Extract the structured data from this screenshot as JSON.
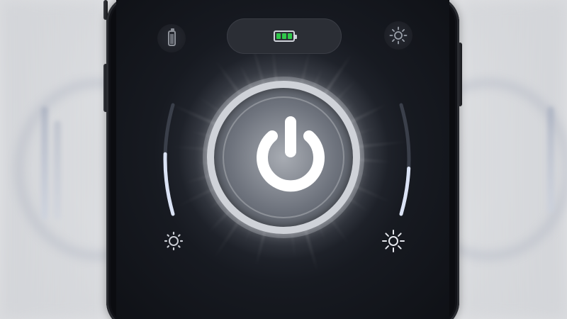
{
  "app": {
    "name": "",
    "state": "on"
  },
  "status": {
    "battery_level": 1.0,
    "battery_color": "#2fc84a"
  },
  "controls": {
    "power_icon": "power-icon",
    "left_slider_level": 0.55,
    "right_slider_level": 0.42,
    "top_left_icon": "battery-icon",
    "top_right_icon": "sun-icon",
    "bottom_left_icon": "sun-low-icon",
    "bottom_right_icon": "sun-high-icon"
  },
  "colors": {
    "screen_bg": "#171a21",
    "accent_glow": "#ffffff",
    "ring": "#cfd2d8",
    "slider_track": "#3a3f4a",
    "slider_fill": "#dbe3f5"
  }
}
